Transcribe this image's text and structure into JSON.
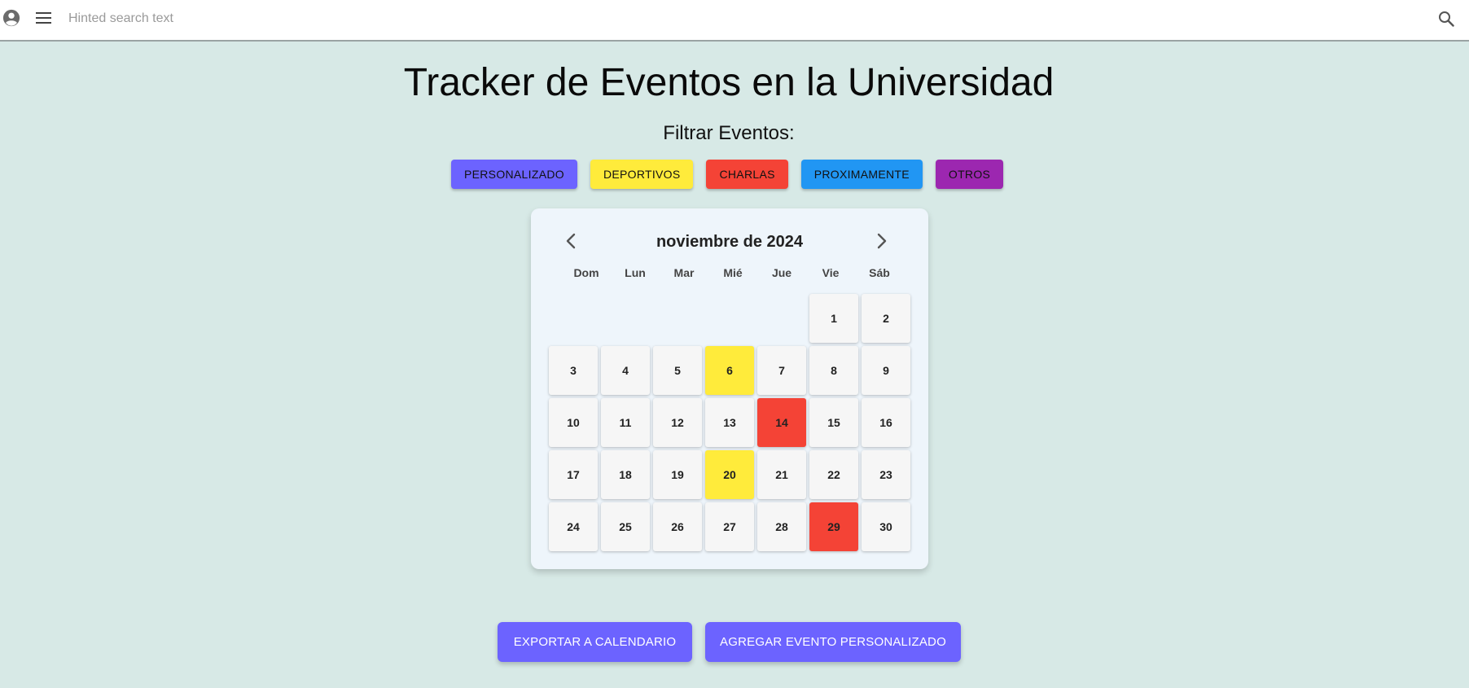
{
  "header": {
    "search_placeholder": "Hinted search text",
    "avatar_icon": "account-circle-icon",
    "menu_icon": "hamburger-menu-icon",
    "search_icon": "magnifier-icon"
  },
  "main": {
    "title": "Tracker de Eventos en la Universidad",
    "filter_label": "Filtrar Eventos:"
  },
  "filters": [
    {
      "label": "PERSONALIZADO",
      "color": "#6c63ff"
    },
    {
      "label": "DEPORTIVOS",
      "color": "#ffeb3b"
    },
    {
      "label": "CHARLAS",
      "color": "#f44336"
    },
    {
      "label": "PROXIMAMENTE",
      "color": "#2196f3"
    },
    {
      "label": "OTROS",
      "color": "#9c27b0"
    }
  ],
  "calendar": {
    "month_label": "noviembre de 2024",
    "prev_icon": "chevron-left-icon",
    "next_icon": "chevron-right-icon",
    "weekdays": [
      "Dom",
      "Lun",
      "Mar",
      "Mié",
      "Jue",
      "Vie",
      "Sáb"
    ],
    "first_weekday_index": 5,
    "days_in_month": 30,
    "events": {
      "6": "#ffeb3b",
      "14": "#f44336",
      "20": "#ffeb3b",
      "29": "#f44336"
    },
    "default_day_color": "#f6f6f6"
  },
  "actions": {
    "export_label": "EXPORTAR A CALENDARIO",
    "add_label": "AGREGAR EVENTO PERSONALIZADO",
    "color": "#6c63ff"
  }
}
